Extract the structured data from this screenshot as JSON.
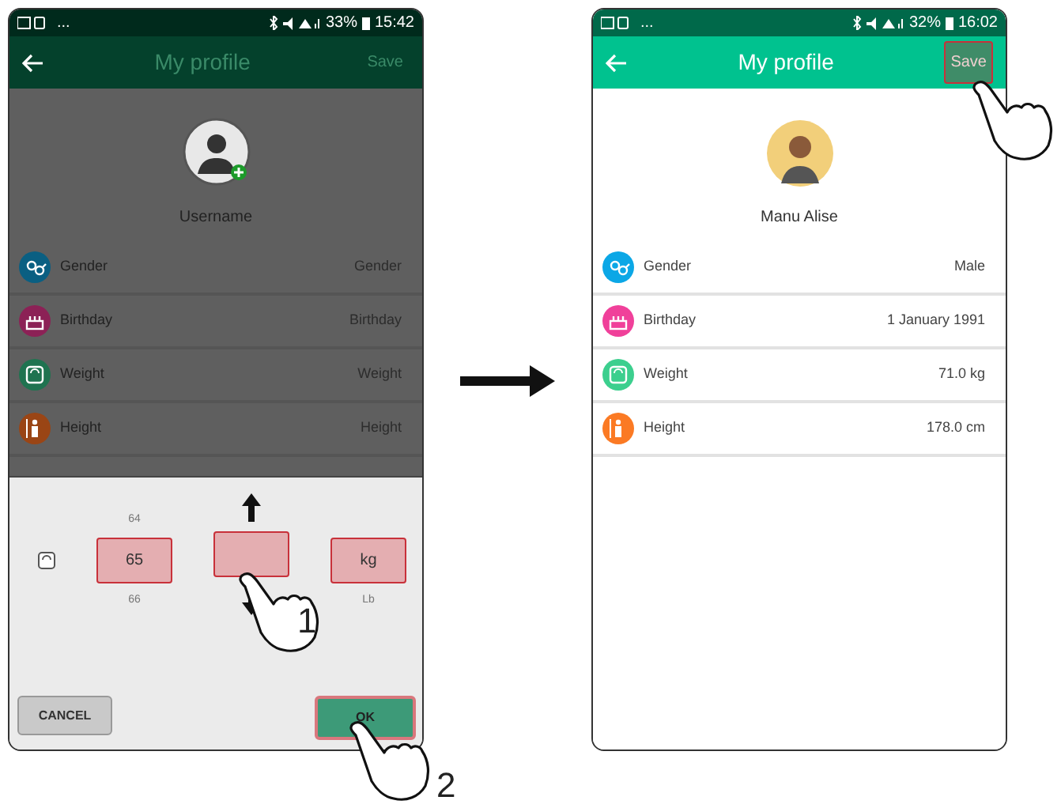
{
  "screens": [
    {
      "dimmed": true,
      "status_bar": {
        "notifications": "...",
        "battery": "33%",
        "time": "15:42"
      },
      "header": {
        "title": "My profile",
        "action": "Save",
        "action_highlighted": false
      },
      "avatar": {
        "kind": "placeholder"
      },
      "username": "Username",
      "fields": [
        {
          "label": "Gender",
          "placeholder": "Gender",
          "color": "#0a5f82"
        },
        {
          "label": "Birthday",
          "placeholder": "Birthday",
          "color": "#8c2156"
        },
        {
          "label": "Weight",
          "placeholder": "Weight",
          "color": "#1f7350"
        },
        {
          "label": "Height",
          "placeholder": "Height",
          "color": "#9a4515"
        }
      ],
      "picker": {
        "columns": [
          {
            "above": "64",
            "value": "65",
            "below": "66"
          },
          {
            "arrows": true
          },
          {
            "value": "kg",
            "below": "Lb"
          }
        ],
        "cancel": "CANCEL",
        "ok": "OK",
        "ok_highlighted": true
      }
    },
    {
      "dimmed": false,
      "status_bar": {
        "notifications": "...",
        "battery": "32%",
        "time": "16:02"
      },
      "header": {
        "title": "My profile",
        "action": "Save",
        "action_highlighted": true
      },
      "avatar": {
        "kind": "cartoon"
      },
      "username": "Manu Alise",
      "fields": [
        {
          "label": "Gender",
          "value": "Male",
          "color": "#0ba7e6"
        },
        {
          "label": "Birthday",
          "value": "1 January 1991",
          "color": "#f0409a"
        },
        {
          "label": "Weight",
          "value": "71.0 kg",
          "color": "#3ccf8e"
        },
        {
          "label": "Height",
          "value": "178.0 cm",
          "color": "#fb7a24"
        }
      ]
    }
  ],
  "steps": [
    "1",
    "2"
  ]
}
